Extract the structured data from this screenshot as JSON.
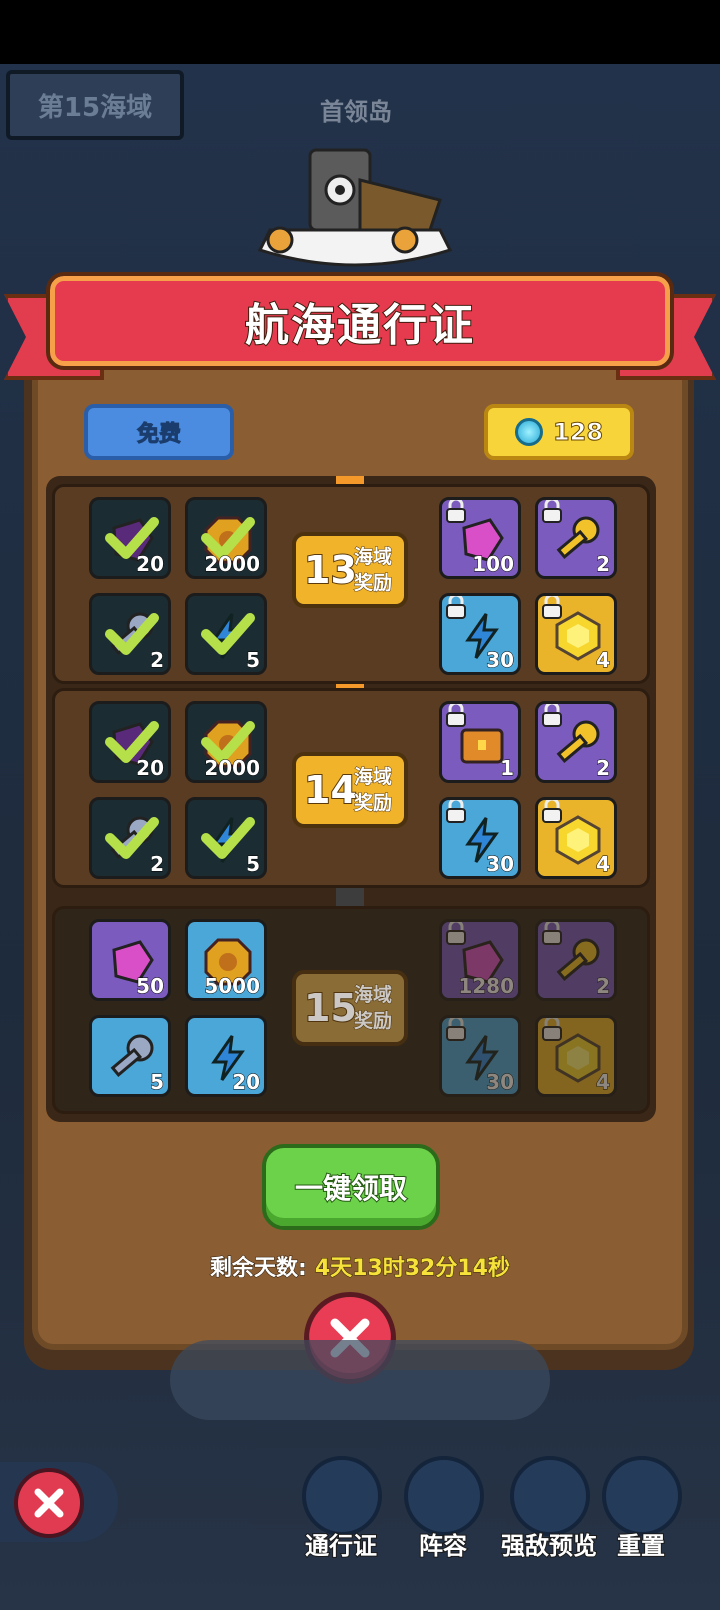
{
  "zone_tag": "第15海域",
  "island_label": "首领岛",
  "title": "航海通行证",
  "free_label": "免费",
  "gem_count": "128",
  "rows": [
    {
      "level": "13",
      "label1": "海域",
      "label2": "奖励",
      "free": [
        {
          "icon": "purple-crystal-icon",
          "count": "20"
        },
        {
          "icon": "gold-coin-icon",
          "count": "2000"
        },
        {
          "icon": "silver-key-icon",
          "count": "2"
        },
        {
          "icon": "energy-bolt-icon",
          "count": "5"
        }
      ],
      "paid": [
        {
          "icon": "pink-gem-icon",
          "count": "100"
        },
        {
          "icon": "gold-key-icon",
          "count": "2"
        },
        {
          "icon": "energy-bolt-icon",
          "count": "30"
        },
        {
          "icon": "gold-hexagon-icon",
          "count": "4"
        }
      ]
    },
    {
      "level": "14",
      "label1": "海域",
      "label2": "奖励",
      "free": [
        {
          "icon": "purple-crystal-icon",
          "count": "20"
        },
        {
          "icon": "gold-coin-icon",
          "count": "2000"
        },
        {
          "icon": "silver-key-icon",
          "count": "2"
        },
        {
          "icon": "energy-bolt-icon",
          "count": "5"
        }
      ],
      "paid": [
        {
          "icon": "treasure-chest-icon",
          "count": "1"
        },
        {
          "icon": "gold-key-icon",
          "count": "2"
        },
        {
          "icon": "energy-bolt-icon",
          "count": "30"
        },
        {
          "icon": "gold-hexagon-icon",
          "count": "4"
        }
      ]
    },
    {
      "level": "15",
      "label1": "海域",
      "label2": "奖励",
      "free": [
        {
          "icon": "pink-gem-icon",
          "count": "50"
        },
        {
          "icon": "gold-coin-icon",
          "count": "5000"
        },
        {
          "icon": "silver-key-icon",
          "count": "5"
        },
        {
          "icon": "energy-bolt-icon",
          "count": "20"
        }
      ],
      "paid": [
        {
          "icon": "pink-gem-icon",
          "count": "1280"
        },
        {
          "icon": "gold-key-icon",
          "count": "2"
        },
        {
          "icon": "energy-bolt-icon",
          "count": "30"
        },
        {
          "icon": "gold-hexagon-icon",
          "count": "4"
        }
      ]
    }
  ],
  "claim_all": "一键领取",
  "remaining_label": "剩余天数:",
  "remaining_value": "4天13时32分14秒",
  "nav": [
    {
      "label": "通行证"
    },
    {
      "label": "阵容"
    },
    {
      "label": "强敌预览"
    },
    {
      "label": "重置"
    }
  ]
}
